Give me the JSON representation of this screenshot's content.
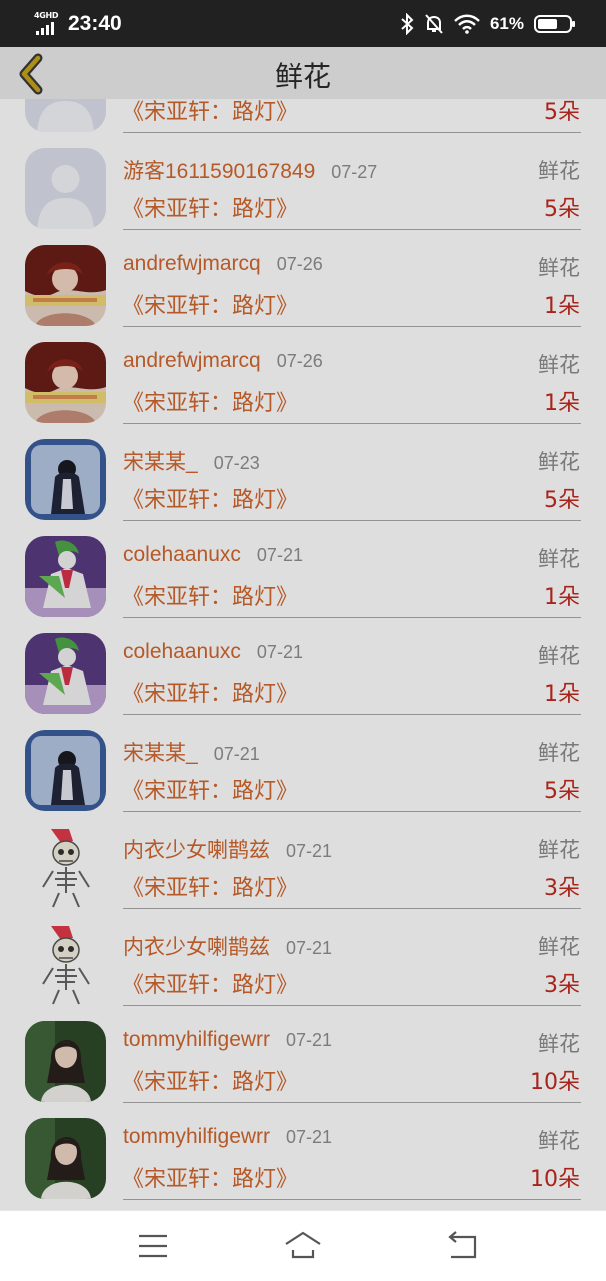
{
  "status_bar": {
    "network": "4GHD",
    "time": "23:40",
    "battery": "61%",
    "icons": [
      "signal-icon",
      "bluetooth-icon",
      "bell-off-icon",
      "wifi-icon",
      "battery-icon"
    ]
  },
  "header": {
    "title": "鲜花",
    "back_icon": "chevron-left-icon",
    "accent": "#c8a51a"
  },
  "colors": {
    "username": "#d2672e",
    "count": "#c22a1e",
    "meta": "#8f8f8f"
  },
  "gifts": [
    {
      "user": "",
      "date": "",
      "type": "",
      "work": "《宋亚轩：路灯》",
      "count": "5朵",
      "avatar": "default"
    },
    {
      "user": "游客1611590167849",
      "date": "07-27",
      "type": "鲜花",
      "work": "《宋亚轩：路灯》",
      "count": "5朵",
      "avatar": "default"
    },
    {
      "user": "andrefwjmarcq",
      "date": "07-26",
      "type": "鲜花",
      "work": "《宋亚轩：路灯》",
      "count": "1朵",
      "avatar": "girl-illustration"
    },
    {
      "user": "andrefwjmarcq",
      "date": "07-26",
      "type": "鲜花",
      "work": "《宋亚轩：路灯》",
      "count": "1朵",
      "avatar": "girl-illustration"
    },
    {
      "user": "宋某某_",
      "date": "07-23",
      "type": "鲜花",
      "work": "《宋亚轩：路灯》",
      "count": "5朵",
      "avatar": "blue-figure"
    },
    {
      "user": "colehaanuxc",
      "date": "07-21",
      "type": "鲜花",
      "work": "《宋亚轩：路灯》",
      "count": "1朵",
      "avatar": "green-creature"
    },
    {
      "user": "colehaanuxc",
      "date": "07-21",
      "type": "鲜花",
      "work": "《宋亚轩：路灯》",
      "count": "1朵",
      "avatar": "green-creature"
    },
    {
      "user": "宋某某_",
      "date": "07-21",
      "type": "鲜花",
      "work": "《宋亚轩：路灯》",
      "count": "5朵",
      "avatar": "blue-figure"
    },
    {
      "user": "内衣少女喇鹊兹",
      "date": "07-21",
      "type": "鲜花",
      "work": "《宋亚轩：路灯》",
      "count": "3朵",
      "avatar": "skeleton"
    },
    {
      "user": "内衣少女喇鹊兹",
      "date": "07-21",
      "type": "鲜花",
      "work": "《宋亚轩：路灯》",
      "count": "3朵",
      "avatar": "skeleton"
    },
    {
      "user": "tommyhilfigewrr",
      "date": "07-21",
      "type": "鲜花",
      "work": "《宋亚轩：路灯》",
      "count": "10朵",
      "avatar": "portrait-photo"
    },
    {
      "user": "tommyhilfigewrr",
      "date": "07-21",
      "type": "鲜花",
      "work": "《宋亚轩：路灯》",
      "count": "10朵",
      "avatar": "portrait-photo"
    }
  ],
  "nav_bar": {
    "buttons": [
      "menu-icon",
      "home-icon",
      "back-icon"
    ]
  }
}
